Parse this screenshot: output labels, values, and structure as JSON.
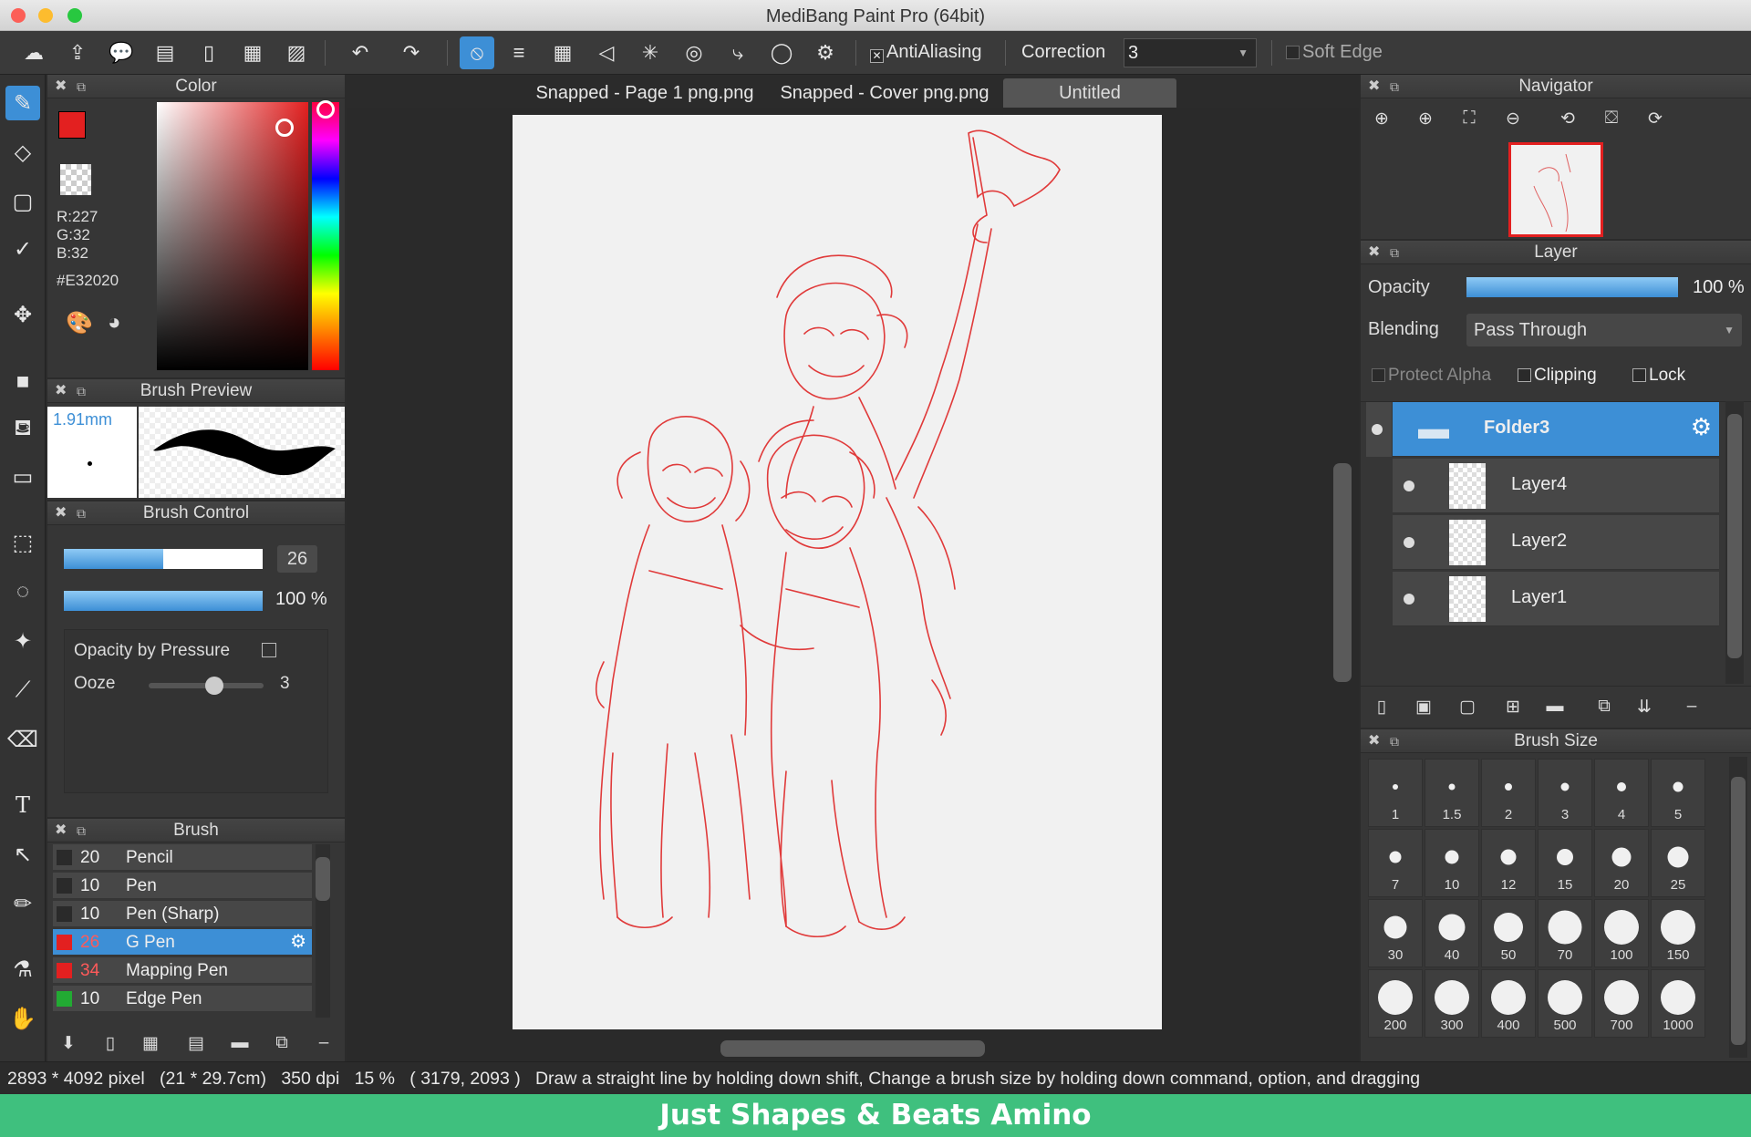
{
  "window": {
    "title": "MediBang Paint Pro (64bit)"
  },
  "toolbar": {
    "antialiasing_label": "AntiAliasing",
    "correction_label": "Correction",
    "correction_value": "3",
    "soft_edge_label": "Soft Edge"
  },
  "tabs": [
    {
      "label": "Snapped - Page 1 png.png"
    },
    {
      "label": "Snapped - Cover png.png"
    },
    {
      "label": "Untitled"
    }
  ],
  "color_panel": {
    "title": "Color",
    "r": "R:227",
    "g": "G:32",
    "b": "B:32",
    "hex": "#E32020",
    "foreground": "#e32020"
  },
  "brush_preview": {
    "title": "Brush Preview",
    "size": "1.91mm"
  },
  "brush_control": {
    "title": "Brush Control",
    "size_value": "26",
    "size_fraction": 0.5,
    "opacity_value": "100 %",
    "opacity_fraction": 1.0,
    "opacity_by_pressure_label": "Opacity by Pressure",
    "ooze_label": "Ooze",
    "ooze_value": "3"
  },
  "brush_panel": {
    "title": "Brush",
    "items": [
      {
        "size": "20",
        "name": "Pencil",
        "color": "#2a2a2a"
      },
      {
        "size": "10",
        "name": "Pen",
        "color": "#2a2a2a"
      },
      {
        "size": "10",
        "name": "Pen (Sharp)",
        "color": "#2a2a2a"
      },
      {
        "size": "26",
        "name": "G Pen",
        "color": "#e32020"
      },
      {
        "size": "34",
        "name": "Mapping Pen",
        "color": "#e32020"
      },
      {
        "size": "10",
        "name": "Edge Pen",
        "color": "#22aa33"
      }
    ]
  },
  "navigator": {
    "title": "Navigator"
  },
  "layer_panel": {
    "title": "Layer",
    "opacity_label": "Opacity",
    "opacity_value": "100 %",
    "blending_label": "Blending",
    "blending_value": "Pass Through",
    "protect_alpha_label": "Protect Alpha",
    "clipping_label": "Clipping",
    "lock_label": "Lock",
    "layers": [
      {
        "name": "Folder3"
      },
      {
        "name": "Layer4"
      },
      {
        "name": "Layer2"
      },
      {
        "name": "Layer1"
      }
    ]
  },
  "brush_size_panel": {
    "title": "Brush Size",
    "sizes": [
      "1",
      "1.5",
      "2",
      "3",
      "4",
      "5",
      "7",
      "10",
      "12",
      "15",
      "20",
      "25",
      "30",
      "40",
      "50",
      "70",
      "100",
      "150",
      "200",
      "300",
      "400",
      "500",
      "700",
      "1000"
    ]
  },
  "status": {
    "dimensions": "2893 * 4092 pixel",
    "physical": "(21 * 29.7cm)",
    "dpi": "350 dpi",
    "zoom": "15 %",
    "coords": "( 3179, 2093 )",
    "hint": "Draw a straight line by holding down shift, Change a brush size by holding down command, option, and dragging"
  },
  "footer_brand": "Just Shapes & Beats Amino"
}
